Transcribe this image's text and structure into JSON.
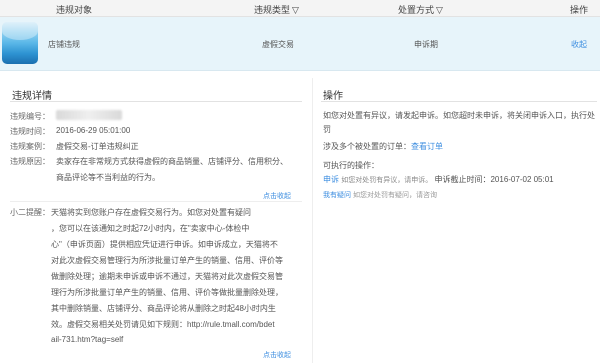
{
  "header": {
    "col_object": "违规对象",
    "col_type": "违规类型",
    "col_method": "处置方式",
    "col_action": "操作",
    "filter_icon": "filter-icon",
    "bg_color": "#f4f4f4"
  },
  "row": {
    "object": "店铺违规",
    "type": "虚假交易",
    "method": "申诉期",
    "action": "收起",
    "bg_color": "#e7f4fa"
  },
  "details": {
    "title": "违规详情",
    "id_label": "违规编号：",
    "time_label": "违规时间：",
    "time_value": "2016-06-29 05:01:00",
    "case_label": "违规案例：",
    "case_value": "虚假交易-订单违规纠正",
    "reason_label": "违规原因：",
    "reason_lines": [
      "卖家存在非常规方式获得虚假的商品销量、店铺评分、信用积分、",
      "商品评论等不当利益的行为。"
    ],
    "collapse_1": "点击收起",
    "tip_label": "小二提醒：",
    "tip_lines": [
      "天猫将实到您账户存在虚假交易行为。如您对处置有疑问",
      "，您可以在该通知之时起72小时内，在\"卖家中心-体检中",
      "心\"（申诉页面）提供相应凭证进行申诉。如申诉成立，天猫将不",
      "对此次虚假交易管理行为所涉批量订单产生的销量、信用、评价等",
      "做删除处理；逾期未申诉或申诉不通过，天猫将对此次虚假交易管",
      "理行为所涉批量订单产生的销量、信用、评价等做批量删除处理，",
      "其中删除销量、店铺评分、商品评论将从删除之时起48小时内生",
      "效。虚假交易相关处罚请见如下规则：http://rule.tmall.com/bdet",
      "ail-731.htm?tag=self"
    ],
    "collapse_2": "点击收起"
  },
  "ops": {
    "title": "操作",
    "intro_lines": [
      "如您对处置有异议，请发起申诉。如您超时未申诉，将关闭申诉入口，执行处",
      "罚"
    ],
    "orders_text": "涉及多个被处置的订单：",
    "orders_link": "查看订单",
    "exec_label": "可执行的操作：",
    "appeal_link": "申诉",
    "appeal_desc": "如您对处罚有异议，请申诉。",
    "deadline": "申诉截止时间：2016-07-02 05:01",
    "question_link": "我有疑问",
    "question_desc": "如您对处罚有疑问，请咨询"
  },
  "colors": {
    "link": "#3d8ee0",
    "accent": "#e8692a"
  }
}
